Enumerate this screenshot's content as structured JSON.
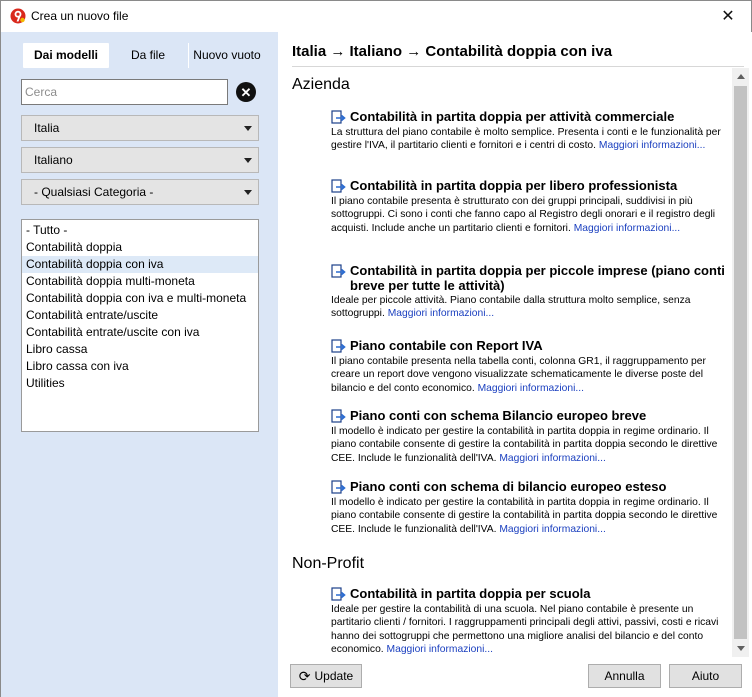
{
  "window": {
    "title": "Crea un nuovo file",
    "close_label": "✕"
  },
  "tabs": {
    "models": "Dai modelli",
    "file": "Da file",
    "empty": "Nuovo vuoto"
  },
  "search": {
    "placeholder": "Cerca",
    "value": ""
  },
  "filters": {
    "country": "Italia",
    "language": "Italiano",
    "category": "- Qualsiasi Categoria -"
  },
  "categories": [
    "- Tutto -",
    "Contabilità doppia",
    "Contabilità doppia con iva",
    "Contabilità doppia multi-moneta",
    "Contabilità doppia con iva e multi-moneta",
    "Contabilità entrate/uscite",
    "Contabilità entrate/uscite con iva",
    "Libro cassa",
    "Libro cassa con iva",
    "Utilities"
  ],
  "selected_category_index": 2,
  "breadcrumb": "Italia → Italiano → Contabilità doppia con iva",
  "more_link": "Maggiori informazioni...",
  "sections": [
    {
      "name": "Azienda",
      "templates": [
        {
          "title": "Contabilità in partita doppia per attività commerciale",
          "description": "La struttura del piano contabile è molto semplice. Presenta i conti e le funzionalità per gestire l'IVA, il partitario clienti e fornitori e i centri di costo."
        },
        {
          "title": "Contabilità in partita doppia per libero professionista",
          "description": "Il piano contabile presenta è strutturato con dei gruppi principali, suddivisi in più sottogruppi. Ci sono i conti che fanno capo al Registro degli onorari e il registro degli acquisti. Include anche un partitario clienti e fornitori."
        },
        {
          "title": "Contabilità in partita doppia per piccole imprese (piano conti breve per tutte le attività)",
          "description": "Ideale per piccole attività. Piano contabile dalla struttura molto semplice, senza sottogruppi."
        },
        {
          "title": "Piano contabile con Report IVA",
          "description": "Il piano contabile presenta nella tabella conti, colonna GR1, il raggruppamento per creare un report dove vengono visualizzate schematicamente le diverse poste del bilancio e del conto economico."
        },
        {
          "title": "Piano conti con schema Bilancio europeo breve",
          "description": "Il modello è indicato per gestire la contabilità in partita doppia in regime ordinario. Il piano contabile consente di gestire la contabilità in partita doppia secondo le direttive CEE. Include le funzionalità dell'IVA."
        },
        {
          "title": "Piano conti con schema di bilancio europeo esteso",
          "description": "Il modello è indicato per gestire la contabilità in partita doppia in regime ordinario. Il piano contabile consente di gestire la contabilità in partita doppia secondo le direttive CEE. Include le funzionalità dell'IVA."
        }
      ]
    },
    {
      "name": "Non-Profit",
      "templates": [
        {
          "title": "Contabilità in partita doppia per scuola",
          "description": "Ideale per gestire la contabilità di una scuola. Nel piano contabile è presente un partitario clienti / fornitori. I raggruppamenti principali degli attivi, passivi, costi e ricavi hanno dei sottogruppi che permettono una migliore analisi del bilancio e del conto economico."
        }
      ]
    }
  ],
  "buttons": {
    "update": "Update",
    "cancel": "Annulla",
    "help": "Aiuto"
  }
}
